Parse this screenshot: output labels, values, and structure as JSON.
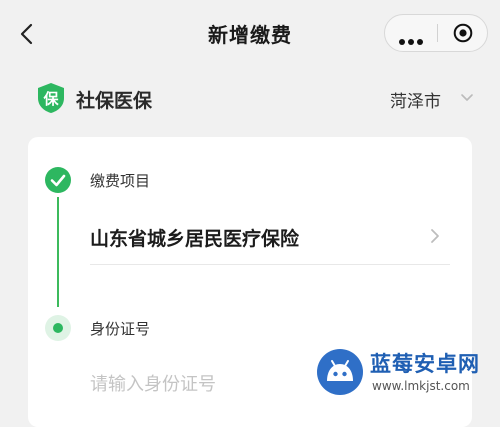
{
  "header": {
    "title": "新增缴费",
    "back_icon": "chevron-left-icon",
    "more_icon": "more-dots-icon",
    "close_icon": "target-close-icon"
  },
  "service": {
    "logo_char": "保",
    "name": "社保医保",
    "city": "菏泽市",
    "brand_color": "#2db760"
  },
  "card": {
    "steps": [
      {
        "title": "缴费项目",
        "status": "completed",
        "value": "山东省城乡居民医疗保险"
      },
      {
        "title": "身份证号",
        "status": "active",
        "placeholder": "请输入身份证号",
        "value": ""
      }
    ],
    "accent_color": "#3cba5c"
  },
  "watermark": {
    "title": "蓝莓安卓网",
    "url": "www.lmkjst.com"
  }
}
